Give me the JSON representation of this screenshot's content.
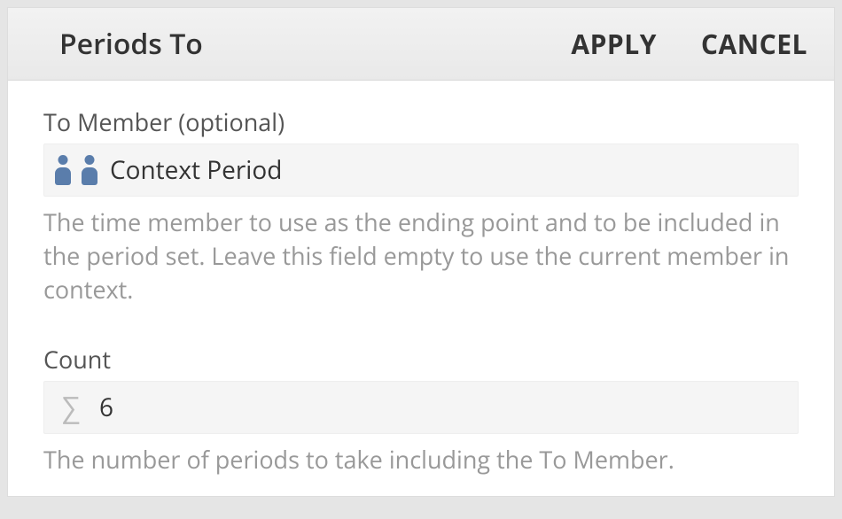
{
  "header": {
    "title": "Periods To",
    "apply_label": "APPLY",
    "cancel_label": "CANCEL"
  },
  "fields": {
    "to_member": {
      "label": "To Member (optional)",
      "value": "Context Period",
      "help": "The time member to use as the ending point and to be included in the period set. Leave this field empty to use the current member in context."
    },
    "count": {
      "label": "Count",
      "value": "6",
      "help": "The number of periods to take including the To Member."
    }
  }
}
